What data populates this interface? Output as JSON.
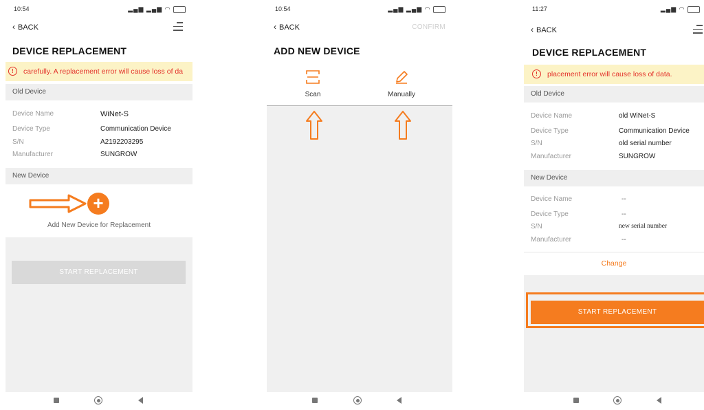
{
  "screen1": {
    "time": "10:54",
    "back": "BACK",
    "title": "DEVICE REPLACEMENT",
    "warning": "carefully. A replacement error will cause loss of da",
    "old_section": "Old Device",
    "old": {
      "labels": [
        "Device Name",
        "Device Type",
        "S/N",
        "Manufacturer"
      ],
      "values": [
        "WiNet-S",
        "Communication Device",
        "A2192203295",
        "SUNGROW"
      ]
    },
    "new_section": "New Device",
    "add_label": "Add New Device for Replacement",
    "start": "START REPLACEMENT"
  },
  "screen2": {
    "time": "10:54",
    "back": "BACK",
    "confirm": "CONFIRM",
    "title": "ADD NEW DEVICE",
    "scan": "Scan",
    "manually": "Manually"
  },
  "screen3": {
    "time": "11:27",
    "back": "BACK",
    "title": "DEVICE REPLACEMENT",
    "warning": "placement error will cause loss of data.",
    "old_section": "Old Device",
    "old": {
      "labels": [
        "Device Name",
        "Device Type",
        "S/N",
        "Manufacturer"
      ],
      "values": [
        "old WiNet-S",
        "Communication Device",
        "old serial number",
        "SUNGROW"
      ]
    },
    "new_section": "New Device",
    "new": {
      "labels": [
        "Device Name",
        "Device Type",
        "S/N",
        "Manufacturer"
      ],
      "values": [
        "--",
        "--",
        "new serial number",
        "--"
      ]
    },
    "change": "Change",
    "start": "START REPLACEMENT"
  },
  "colors": {
    "accent": "#f57c1f",
    "warning_text": "#e3322b",
    "warning_bg": "#fcf3c6"
  },
  "icons": [
    "back-chevron-icon",
    "menu-icon",
    "warning-icon",
    "add-icon",
    "scan-icon",
    "pencil-icon",
    "arrow-right-icon",
    "arrow-up-icon"
  ]
}
